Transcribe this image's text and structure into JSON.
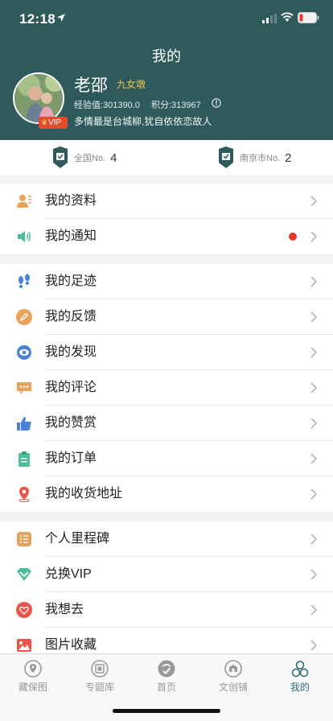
{
  "status_bar": {
    "time": "12:18"
  },
  "header": {
    "title": "我的",
    "username": "老邵",
    "level": "九女墩",
    "vip_badge": "VIP",
    "exp": "经验值:301390.0",
    "points": "积分:313967",
    "motto": "多情最是台城柳,犹自依依恋故人"
  },
  "ranks": [
    {
      "label": "全国No.",
      "value": "4"
    },
    {
      "label": "南京市No.",
      "value": "2"
    }
  ],
  "menu_group_1": [
    {
      "label": "我的资料",
      "icon": "profile-icon"
    },
    {
      "label": "我的通知",
      "icon": "speaker-icon",
      "has_dot": true
    }
  ],
  "menu_group_2": [
    {
      "label": "我的足迹",
      "icon": "footprint-icon"
    },
    {
      "label": "我的反馈",
      "icon": "feedback-icon"
    },
    {
      "label": "我的发现",
      "icon": "eye-icon"
    },
    {
      "label": "我的评论",
      "icon": "comment-icon"
    },
    {
      "label": "我的赞赏",
      "icon": "thumbs-up-icon"
    },
    {
      "label": "我的订单",
      "icon": "clipboard-icon"
    },
    {
      "label": "我的收货地址",
      "icon": "location-pin-icon"
    }
  ],
  "menu_group_3": [
    {
      "label": "个人里程碑",
      "icon": "milestone-icon"
    },
    {
      "label": "兑换VIP",
      "icon": "vip-diamond-icon"
    },
    {
      "label": "我想去",
      "icon": "heart-icon"
    },
    {
      "label": "图片收藏",
      "icon": "image-icon"
    }
  ],
  "tabbar": [
    {
      "label": "藏保图",
      "icon": "map-pin-icon"
    },
    {
      "label": "专题库",
      "icon": "topic-icon"
    },
    {
      "label": "首页",
      "icon": "home-icon"
    },
    {
      "label": "文创铺",
      "icon": "shop-icon"
    },
    {
      "label": "我的",
      "icon": "profile-tab-icon",
      "active": true
    }
  ],
  "colors": {
    "header_bg": "#2f5a5c",
    "accent": "#2f6e72",
    "level": "#f0c64c",
    "notification_dot": "#e8352a"
  }
}
